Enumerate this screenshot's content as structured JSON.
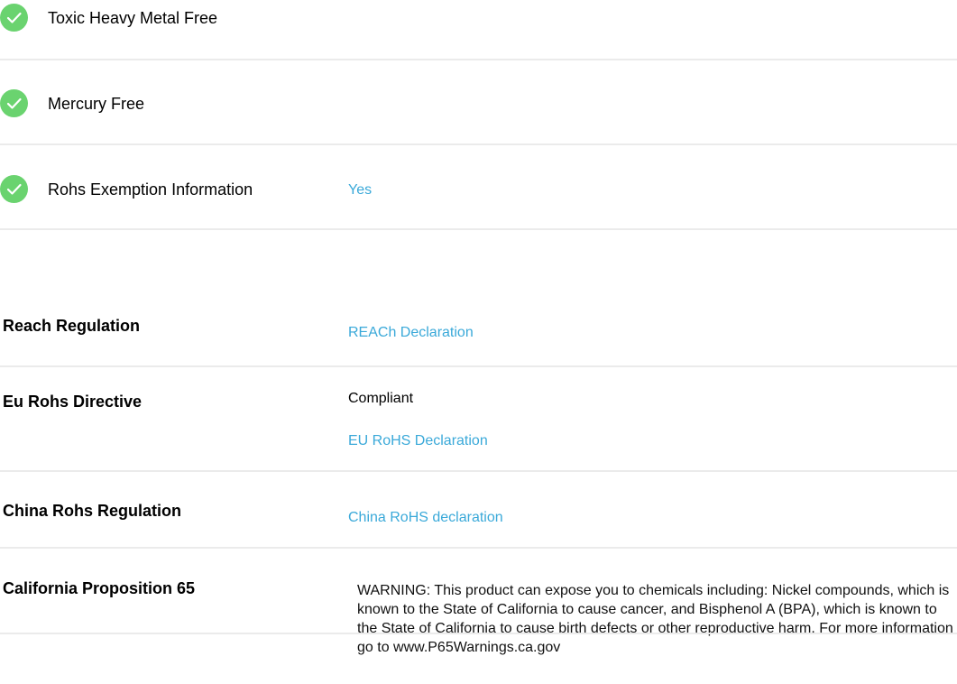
{
  "features": [
    {
      "label": "Toxic Heavy Metal Free",
      "value": "",
      "icon": "check-circle-icon"
    },
    {
      "label": "Mercury Free",
      "value": "",
      "icon": "check-circle-icon"
    },
    {
      "label": "Rohs Exemption Information",
      "value": "Yes",
      "icon": "check-circle-icon"
    }
  ],
  "regulations": [
    {
      "label": "Reach Regulation",
      "status": "",
      "link": "REACh Declaration"
    },
    {
      "label": "Eu Rohs Directive",
      "status": "Compliant",
      "link": "EU RoHS Declaration"
    },
    {
      "label": "China Rohs Regulation",
      "status": "",
      "link": "China RoHS declaration"
    },
    {
      "label": "California Proposition 65",
      "text": "WARNING: This product can expose you to chemicals including: Nickel compounds, which is known to the State of California to cause cancer, and Bisphenol A (BPA), which is known to the State of California to cause birth defects or other reproductive harm. For more information go to www.P65Warnings.ca.gov"
    }
  ],
  "colors": {
    "check": "#6ad36f",
    "link": "#3aa9d9",
    "divider": "#ebebeb"
  }
}
